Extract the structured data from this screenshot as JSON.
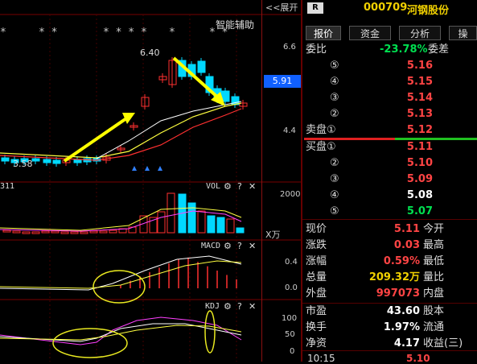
{
  "header": {
    "collapse_label": "<<展开",
    "badge": "R",
    "code": "000709",
    "name": "河钢股份"
  },
  "chart": {
    "assist_label": "智能辅助",
    "high_marker": "6.40",
    "low_marker": "3.58",
    "price_ticks": [
      "6.6",
      "4.4"
    ],
    "current_price_tag": "5.91",
    "star_groups": [
      "*",
      "* *",
      "* * * *",
      "*",
      "* *"
    ],
    "vol_label": "VOL",
    "vol_left_label": "311",
    "vol_tick": "2000",
    "vol_unit": "X万",
    "macd_label": "MACD",
    "macd_ticks": [
      "0.4",
      "0.0"
    ],
    "kdj_label": "KDJ",
    "kdj_ticks": [
      "100",
      "50",
      "0"
    ],
    "gear_icon": "⚙",
    "help_icon": "?",
    "close_icon": "✕",
    "colors": {
      "up": "#ff3030",
      "down": "#00d8ff",
      "ma_yellow": "#ffff40",
      "ma_red": "#ff3030",
      "ma_white": "#ffffff",
      "kdj_magenta": "#ff40ff",
      "arrow": "#ffff00",
      "highlight": "#e8e820"
    }
  },
  "quote_tabs": [
    "报价",
    "资金",
    "分析",
    "操"
  ],
  "order_book": {
    "weibi_label": "委比",
    "weibi_value": "-23.78%",
    "weicha_label": "委差",
    "sell": [
      {
        "label": "⑤",
        "price": "5.16"
      },
      {
        "label": "④",
        "price": "5.15"
      },
      {
        "label": "③",
        "price": "5.14"
      },
      {
        "label": "②",
        "price": "5.13"
      },
      {
        "label": "卖盘①",
        "price": "5.12"
      }
    ],
    "buy": [
      {
        "label": "买盘①",
        "price": "5.11"
      },
      {
        "label": "②",
        "price": "5.10"
      },
      {
        "label": "③",
        "price": "5.09"
      },
      {
        "label": "④",
        "price": "5.08"
      },
      {
        "label": "⑤",
        "price": "5.07"
      }
    ]
  },
  "stats": [
    {
      "label": "现价",
      "value": "5.11",
      "label2": "今开",
      "color": "red"
    },
    {
      "label": "涨跌",
      "value": "0.03",
      "label2": "最高",
      "color": "red"
    },
    {
      "label": "涨幅",
      "value": "0.59%",
      "label2": "最低",
      "color": "red"
    },
    {
      "label": "总量",
      "value": "209.32万",
      "label2": "量比",
      "color": "yellow"
    },
    {
      "label": "外盘",
      "value": "997073",
      "label2": "内盘",
      "color": "red"
    },
    {
      "label": "市盈",
      "value": "43.60",
      "label2": "股本",
      "color": "white"
    },
    {
      "label": "换手",
      "value": "1.97%",
      "label2": "流通",
      "color": "white"
    },
    {
      "label": "净资",
      "value": "4.17",
      "label2": "收益(三)",
      "color": "white"
    }
  ],
  "ticker": {
    "time": "10:15",
    "price": "5.10"
  }
}
